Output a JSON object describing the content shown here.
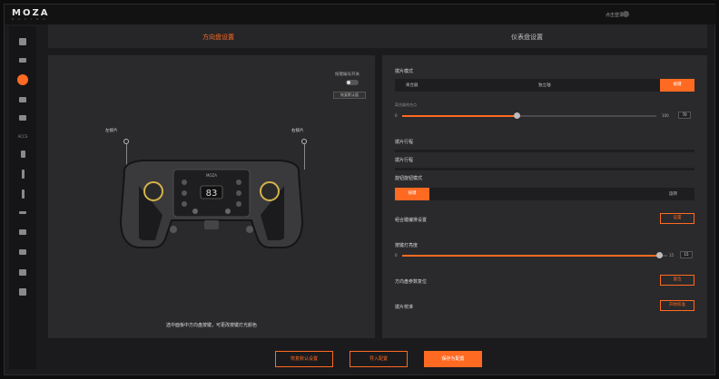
{
  "app": {
    "logo": "MOZA",
    "logo_sub": "RACING",
    "user_label": "点击登录"
  },
  "sidebar": {
    "items": [
      {
        "icon": "home-icon"
      },
      {
        "icon": "camera-icon"
      },
      {
        "icon": "steering-wheel-icon",
        "active": true
      },
      {
        "icon": "base-icon"
      },
      {
        "icon": "dashboard-icon"
      },
      {
        "icon": "text-icon",
        "text": "ACCS"
      },
      {
        "icon": "shifter-icon"
      },
      {
        "icon": "handbrake-icon"
      },
      {
        "icon": "lever-icon"
      },
      {
        "icon": "joystick-icon"
      },
      {
        "icon": "car-icon"
      },
      {
        "icon": "pedal-icon"
      },
      {
        "icon": "stand-icon"
      },
      {
        "icon": "settings-icon"
      }
    ]
  },
  "tabs": {
    "active": "方向盘设置",
    "inactive": "仪表盘设置"
  },
  "left": {
    "toggle_label": "按键编号开关",
    "reset_button": "恢复默认值",
    "left_paddle_label": "左拨片",
    "right_paddle_label": "右拨片",
    "wheel_brand": "MOZA",
    "wheel_display": "83",
    "caption": "选中面板中方向盘按键，可更改按键灯光颜色"
  },
  "right": {
    "paddle_mode_label": "拨片模式",
    "paddle_modes": [
      "离合器",
      "独立轴",
      "按键"
    ],
    "paddle_mode_selected": "按键",
    "slider1_label": "离合器咬合点",
    "slider1_min": "0",
    "slider1_max": "100",
    "slider1_value": "70",
    "slider1_fraction": 0.45,
    "paddle_travel_label": "拨片行程",
    "paddle_travel_label2": "拨片行程",
    "knob_mode_label": "旋钮旋钮模式",
    "knob_modes": [
      "按键",
      "旋转"
    ],
    "knob_mode_selected": "按键",
    "combine_label": "组合键编排设置",
    "combine_button": "设置",
    "brightness_label": "按键灯亮度",
    "brightness_min": "0",
    "brightness_max": "15",
    "brightness_value": "15",
    "brightness_fraction": 0.97,
    "calibrate_label": "方向盘参数复位",
    "calibrate_button": "复位",
    "paddle_cal_label": "拨片校准",
    "paddle_cal_button": "开始校准"
  },
  "bottom": {
    "restore": "恢复默认设置",
    "import": "导入配置",
    "save": "保存为配置"
  },
  "colors": {
    "accent": "#ff6a22",
    "panel": "#2a2a2c",
    "bg": "#1b1b1d"
  }
}
